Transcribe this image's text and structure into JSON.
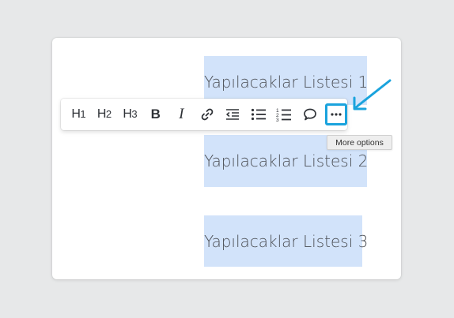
{
  "editor": {
    "lines": [
      "Yapılacaklar Listesi 1",
      "Yapılacaklar Listesi 2",
      "Yapılacaklar Listesi 3"
    ]
  },
  "toolbar": {
    "buttons": [
      {
        "name": "heading-1",
        "label": "H",
        "sub": "1"
      },
      {
        "name": "heading-2",
        "label": "H",
        "sub": "2"
      },
      {
        "name": "heading-3",
        "label": "H",
        "sub": "3"
      },
      {
        "name": "bold",
        "label": "B"
      },
      {
        "name": "italic",
        "label": "I"
      },
      {
        "name": "link",
        "icon": "link-icon"
      },
      {
        "name": "outdent",
        "icon": "outdent-icon"
      },
      {
        "name": "bulleted-list",
        "icon": "bulleted-list-icon"
      },
      {
        "name": "numbered-list",
        "icon": "numbered-list-icon"
      },
      {
        "name": "comment",
        "icon": "comment-icon"
      },
      {
        "name": "more-options",
        "icon": "more-horizontal-icon"
      }
    ]
  },
  "tooltip": {
    "text": "More options"
  },
  "colors": {
    "selection": "#d2e3fa",
    "highlight": "#1aa3dd",
    "text": "#4c4f55"
  }
}
